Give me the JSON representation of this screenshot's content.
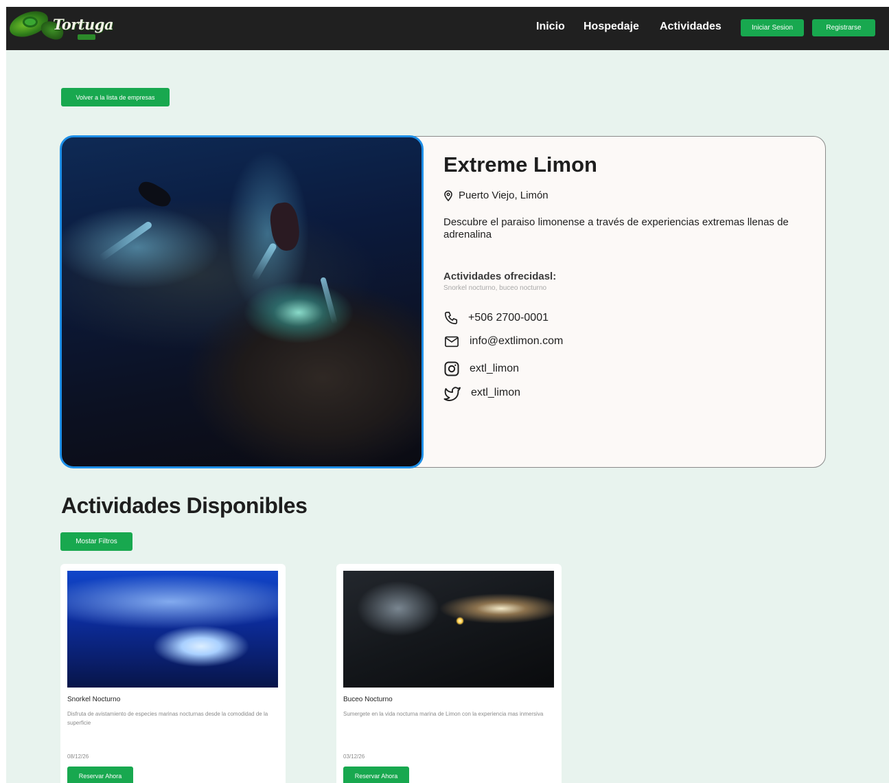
{
  "navbar": {
    "logo_text": "Tortuga",
    "links": [
      "Inicio",
      "Hospedaje",
      "Actividades"
    ],
    "login_label": "Iniciar Sesion",
    "register_label": "Registrarse"
  },
  "back_button": "Volver a la lista de empresas",
  "company": {
    "name": "Extreme Limon",
    "location": "Puerto Viejo, Limón",
    "description": "Descubre el paraiso limonense a través de experiencias extremas llenas de adrenalina",
    "activities_label": "Actividades ofrecidasl:",
    "activities_list": "Snorkel nocturno, buceo nocturno",
    "phone": "+506 2700-0001",
    "email": "info@extlimon.com",
    "instagram": "extl_limon",
    "twitter": "extl_limon"
  },
  "activities": {
    "title": "Actividades Disponibles",
    "filters_label": "Mostar Filtros",
    "items": [
      {
        "title": "Snorkel Nocturno",
        "description": "Disfruta de avistamiento de especies marinas nocturnas desde la comodidad de la superficie",
        "date": "08/12/26",
        "button": "Reservar Ahora"
      },
      {
        "title": "Buceo Nocturno",
        "description": "Sumergete en la vida nocturna marina de Limon con la experiencia mas inmersiva",
        "date": "03/12/26",
        "button": "Reservar Ahora"
      }
    ]
  },
  "colors": {
    "page_bg": "#e8f3ee",
    "navbar_bg": "#202020",
    "accent_green": "#18a84f",
    "image_border_blue": "#1e8fe8",
    "card_bg": "#fcf9f7"
  },
  "icons": [
    "location-pin-icon",
    "phone-icon",
    "mail-icon",
    "instagram-icon",
    "twitter-icon"
  ]
}
